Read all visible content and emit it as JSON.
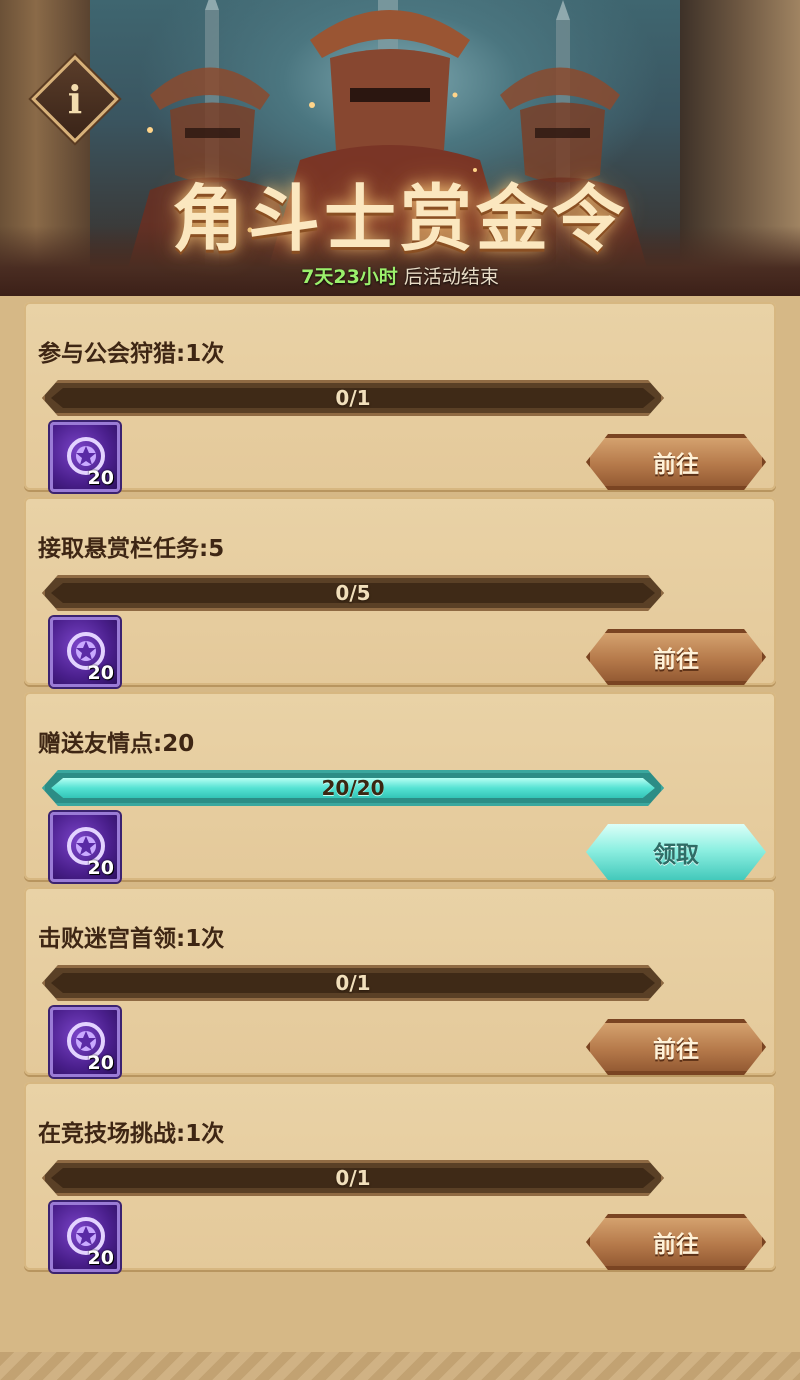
{
  "banner": {
    "title": "角斗士赏金令",
    "countdown_time": "7天23小时",
    "countdown_suffix": "后活动结束",
    "info_icon": "info-icon"
  },
  "tasks": [
    {
      "title": "参与公会狩猎:1次",
      "progress_text": "0/1",
      "progress": 0,
      "reward_icon": "purple-coin-icon",
      "reward_count": "20",
      "button_label": "前往",
      "button_state": "go"
    },
    {
      "title": "接取悬赏栏任务:5",
      "progress_text": "0/5",
      "progress": 0,
      "reward_icon": "purple-coin-icon",
      "reward_count": "20",
      "button_label": "前往",
      "button_state": "go"
    },
    {
      "title": "赠送友情点:20",
      "progress_text": "20/20",
      "progress": 1,
      "reward_icon": "purple-coin-icon",
      "reward_count": "20",
      "button_label": "领取",
      "button_state": "claim"
    },
    {
      "title": "击败迷宫首领:1次",
      "progress_text": "0/1",
      "progress": 0,
      "reward_icon": "purple-coin-icon",
      "reward_count": "20",
      "button_label": "前往",
      "button_state": "go"
    },
    {
      "title": "在竞技场挑战:1次",
      "progress_text": "0/1",
      "progress": 0,
      "reward_icon": "purple-coin-icon",
      "reward_count": "20",
      "button_label": "前往",
      "button_state": "go"
    }
  ],
  "colors": {
    "panel": "#e6cd9f",
    "bar_empty": "#3f2a17",
    "bar_full": "#55e2d3",
    "countdown_time": "#9bf06c",
    "reward_bg": "#4a1f8c"
  }
}
